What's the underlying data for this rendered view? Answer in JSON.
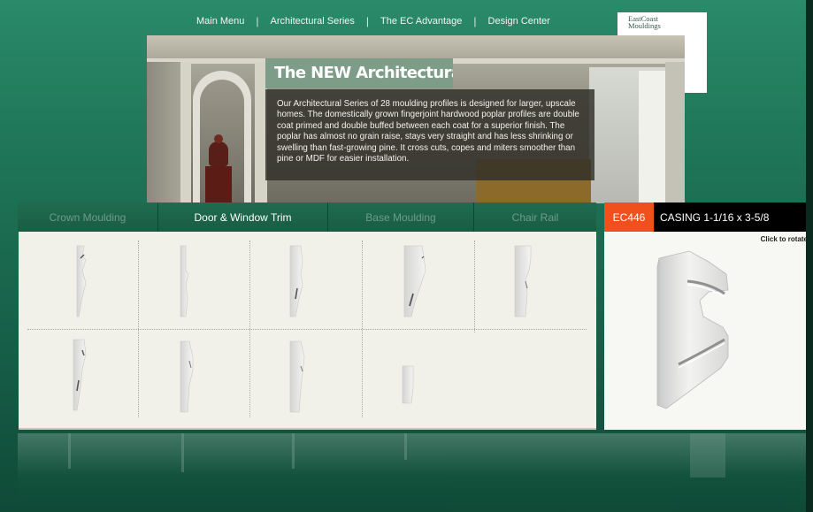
{
  "nav": {
    "items": [
      "Main Menu",
      "Architectural Series",
      "The EC Advantage",
      "Design Center"
    ],
    "separator": "|"
  },
  "logo": {
    "line1": "EastCoast",
    "line2": "Mouldings"
  },
  "hero": {
    "title": "The NEW Architectural Series",
    "body": "Our Architectural Series of 28 moulding profiles is designed for larger, upscale homes. The domestically grown fingerjoint hardwood poplar profiles are double coat primed and double buffed between each coat for a superior finish. The poplar has almost no grain raise, stays very straight and has less shrinking or swelling than fast-growing pine. It cross cuts, copes and miters smoother than pine or MDF for easier installation."
  },
  "tabs": [
    {
      "label": "Crown Moulding",
      "active": false
    },
    {
      "label": "Door & Window Trim",
      "active": true
    },
    {
      "label": "Base Moulding",
      "active": false
    },
    {
      "label": "Chair Rail",
      "active": false
    }
  ],
  "profiles": [
    {
      "name": "profile-1",
      "shape": "a"
    },
    {
      "name": "profile-2",
      "shape": "b"
    },
    {
      "name": "profile-3",
      "shape": "c"
    },
    {
      "name": "profile-4",
      "shape": "d"
    },
    {
      "name": "profile-5",
      "shape": "e"
    },
    {
      "name": "profile-6",
      "shape": "f"
    },
    {
      "name": "profile-7",
      "shape": "g"
    },
    {
      "name": "profile-8",
      "shape": "h"
    },
    {
      "name": "profile-9",
      "shape": "i"
    }
  ],
  "detail": {
    "code": "EC446",
    "title": "CASING 1-1/16 x 3-5/8",
    "hint": "Click to rotate"
  },
  "colors": {
    "background": "#1f7658",
    "accent": "#f0501c",
    "panel": "#f1f0e9",
    "tab": "#1f6c50"
  }
}
